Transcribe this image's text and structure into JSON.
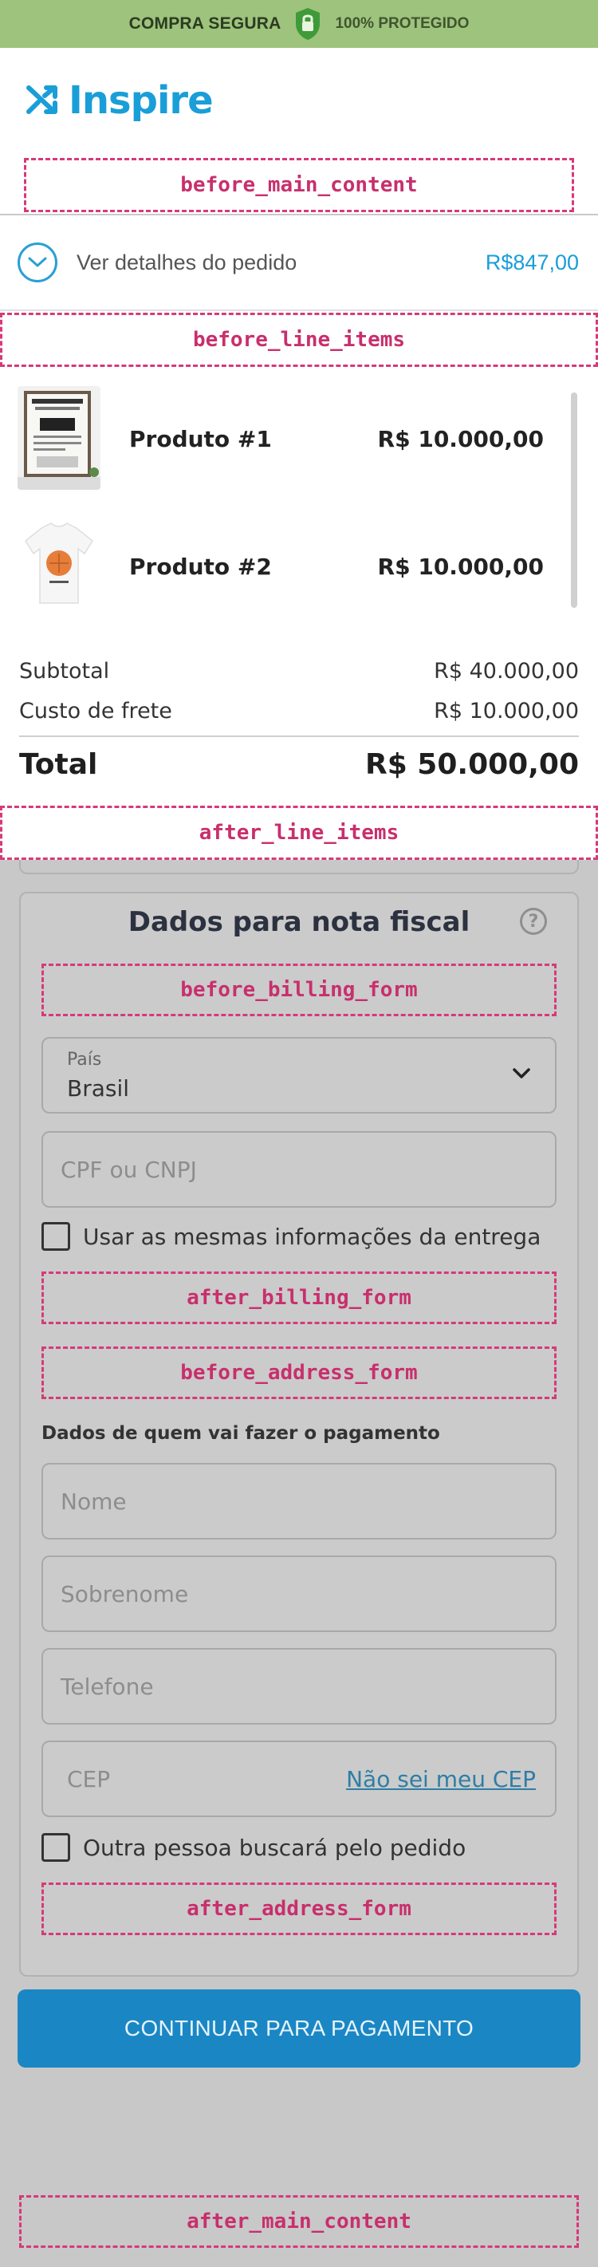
{
  "topbar": {
    "left_text": "COMPRA SEGURA",
    "right_text": "100% PROTEGIDO",
    "bg_color": "#9ec37c"
  },
  "brand": {
    "name": "Inspire",
    "icon": "shuffle-icon",
    "color": "#1a9ed8"
  },
  "hooks": {
    "before_main_content": "before_main_content",
    "before_line_items": "before_line_items",
    "after_line_items": "after_line_items",
    "before_billing_form": "before_billing_form",
    "after_billing_form": "after_billing_form",
    "before_address_form": "before_address_form",
    "after_address_form": "after_address_form",
    "after_main_content": "after_main_content"
  },
  "order_summary": {
    "toggle_label": "Ver detalhes do pedido",
    "price": "R$847,00"
  },
  "line_items": [
    {
      "name": "Produto #1",
      "price": "R$ 10.000,00",
      "thumbnail": "framed-poster-image"
    },
    {
      "name": "Produto #2",
      "price": "R$ 10.000,00",
      "thumbnail": "tshirt-image"
    }
  ],
  "totals": {
    "subtotal_label": "Subtotal",
    "subtotal_value": "R$ 40.000,00",
    "shipping_label": "Custo de frete",
    "shipping_value": "R$ 10.000,00",
    "total_label": "Total",
    "total_value": "R$ 50.000,00"
  },
  "billing_form": {
    "title": "Dados para nota fiscal",
    "help_icon": "question-icon",
    "country": {
      "label": "País",
      "value": "Brasil"
    },
    "document_placeholder": "CPF ou CNPJ",
    "same_info_checkbox": "Usar as mesmas informações da entrega"
  },
  "address_form": {
    "heading": "Dados de quem vai fazer o pagamento",
    "name_placeholder": "Nome",
    "surname_placeholder": "Sobrenome",
    "phone_placeholder": "Telefone",
    "cep_placeholder": "CEP",
    "cep_link": "Não sei meu CEP",
    "pickup_checkbox": "Outra pessoa buscará pelo pedido"
  },
  "cta": {
    "label": "CONTINUAR PARA PAGAMENTO",
    "color": "#1a87c4"
  }
}
